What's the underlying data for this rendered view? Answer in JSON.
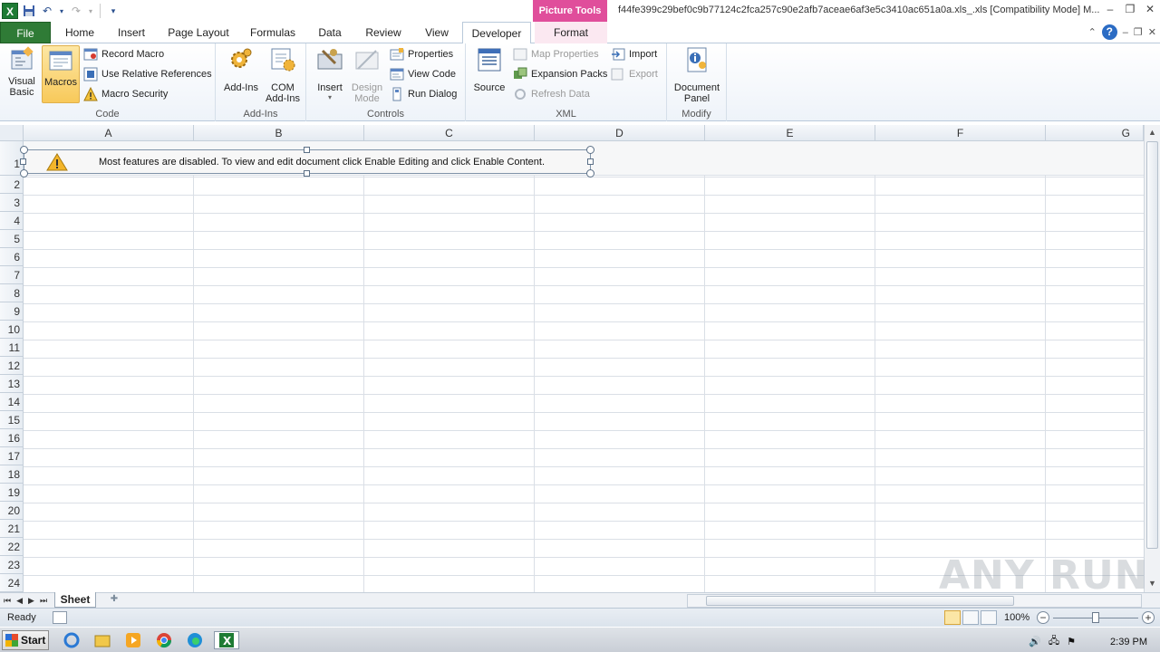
{
  "titlebar": {
    "app_icon": "X",
    "contextual_group": "Picture Tools",
    "window_title": "f44fe399c29bef0c9b77124c2fca257c90e2afb7aceae6af3e5c3410ac651a0a.xls_.xls  [Compatibility Mode] M..."
  },
  "tabs": {
    "file": "File",
    "home": "Home",
    "insert": "Insert",
    "page_layout": "Page Layout",
    "formulas": "Formulas",
    "data": "Data",
    "review": "Review",
    "view": "View",
    "developer": "Developer",
    "format": "Format"
  },
  "ribbon": {
    "code": {
      "label": "Code",
      "visual_basic_1": "Visual",
      "visual_basic_2": "Basic",
      "macros": "Macros",
      "record_macro": "Record Macro",
      "use_relative": "Use Relative References",
      "macro_security": "Macro Security"
    },
    "addins": {
      "label": "Add-Ins",
      "addins": "Add-Ins",
      "com_1": "COM",
      "com_2": "Add-Ins"
    },
    "controls": {
      "label": "Controls",
      "insert": "Insert",
      "design_1": "Design",
      "design_2": "Mode",
      "properties": "Properties",
      "view_code": "View Code",
      "run_dialog": "Run Dialog"
    },
    "xml": {
      "label": "XML",
      "source": "Source",
      "map_properties": "Map Properties",
      "expansion_packs": "Expansion Packs",
      "refresh_data": "Refresh Data",
      "import": "Import",
      "export": "Export"
    },
    "modify": {
      "label": "Modify",
      "doc_1": "Document",
      "doc_2": "Panel"
    }
  },
  "grid": {
    "columns": [
      "A",
      "B",
      "C",
      "D",
      "E",
      "F",
      "G"
    ],
    "rows": [
      "1",
      "2",
      "3",
      "4",
      "5",
      "6",
      "7",
      "8",
      "9",
      "10",
      "11",
      "12",
      "13",
      "14",
      "15",
      "16",
      "17",
      "18",
      "19",
      "20",
      "21",
      "22",
      "23",
      "24"
    ]
  },
  "warning": {
    "text": "Most features are disabled. To view and edit document click Enable Editing and click Enable Content."
  },
  "sheets": {
    "active": "Sheet"
  },
  "status": {
    "ready": "Ready",
    "zoom": "100%"
  },
  "taskbar": {
    "start": "Start",
    "clock": "2:39 PM"
  },
  "watermark": "ANY RUN",
  "colors": {
    "file_tab": "#2f7b36",
    "picture_tools": "#e04e9b",
    "selected_button": "#f8c95a"
  }
}
